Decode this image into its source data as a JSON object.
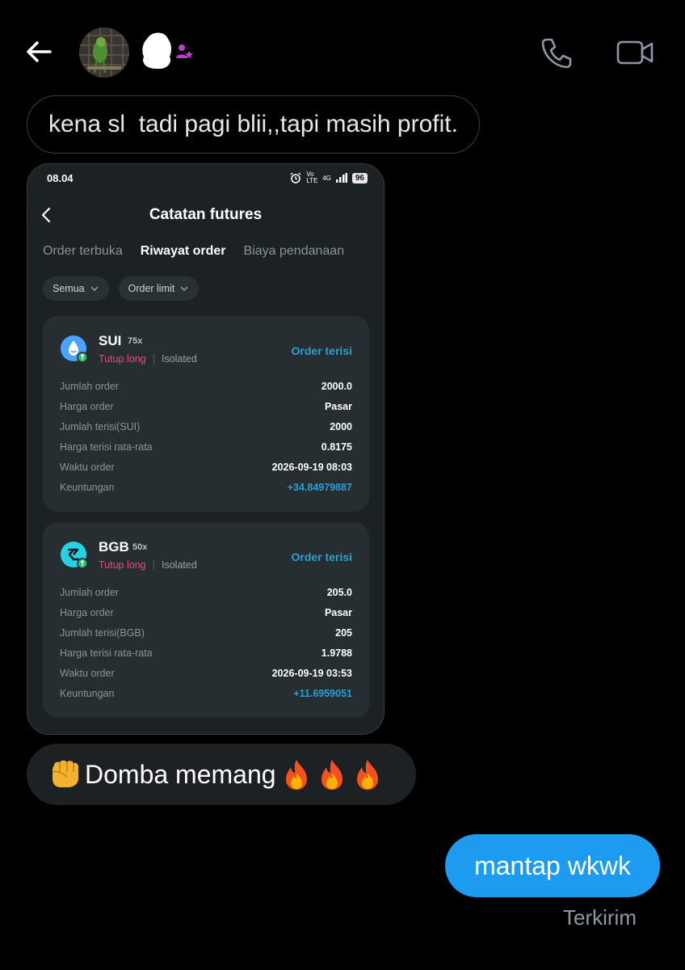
{
  "header": {
    "back_icon": "arrow-left-icon",
    "call_icon": "phone-icon",
    "video_icon": "video-camera-icon",
    "badge_icon": "person-star-icon",
    "badge_color": "#c23bd4"
  },
  "messages": {
    "received_text": "kena sl  tadi pagi blii,,tapi masih profit.",
    "emoji_text": "Domba memang",
    "sent_text": "mantap wkwk",
    "sent_status": "Terkirim"
  },
  "screenshot": {
    "status_bar": {
      "time": "08.04",
      "volte": "Vo LTE",
      "network": "4G",
      "battery": "96"
    },
    "title": "Catatan futures",
    "tabs": [
      {
        "label": "Order terbuka",
        "active": false
      },
      {
        "label": "Riwayat order",
        "active": true
      },
      {
        "label": "Biaya pendanaan",
        "active": false
      }
    ],
    "filters": [
      {
        "label": "Semua"
      },
      {
        "label": "Order limit"
      }
    ],
    "orders": [
      {
        "symbol": "SUI",
        "leverage": "75x",
        "side": "Tutup long",
        "margin_mode": "Isolated",
        "status": "Order terisi",
        "rows": [
          {
            "label": "Jumlah order",
            "value": "2000.0"
          },
          {
            "label": "Harga order",
            "value": "Pasar"
          },
          {
            "label": "Jumlah terisi(SUI)",
            "value": "2000"
          },
          {
            "label": "Harga terisi rata-rata",
            "value": "0.8175"
          },
          {
            "label": "Waktu order",
            "value": "2026-09-19 08:03"
          },
          {
            "label": "Keuntungan",
            "value": "+34.84979887"
          }
        ]
      },
      {
        "symbol": "BGB",
        "leverage": "50x",
        "side": "Tutup long",
        "margin_mode": "Isolated",
        "status": "Order terisi",
        "rows": [
          {
            "label": "Jumlah order",
            "value": "205.0"
          },
          {
            "label": "Harga order",
            "value": "Pasar"
          },
          {
            "label": "Jumlah terisi(BGB)",
            "value": "205"
          },
          {
            "label": "Harga terisi rata-rata",
            "value": "1.9788"
          },
          {
            "label": "Waktu order",
            "value": "2026-09-19 03:53"
          },
          {
            "label": "Keuntungan",
            "value": "+11.6959051"
          }
        ]
      }
    ]
  },
  "colors": {
    "background": "#000000",
    "sent_bubble": "#1d9bf0",
    "profit": "#2a9fd6",
    "close_long": "#e84a7f"
  }
}
